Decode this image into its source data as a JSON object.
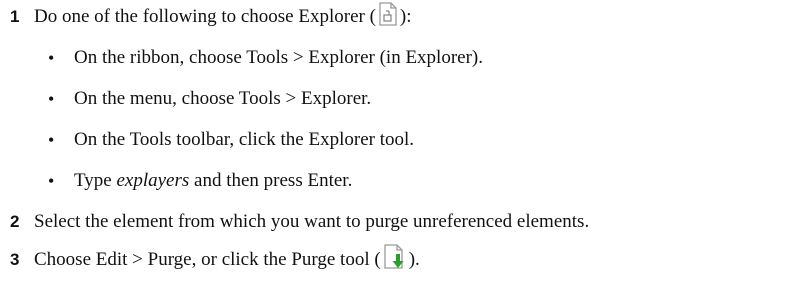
{
  "steps": [
    {
      "number": "1",
      "text_before": "Do one of the following to choose Explorer (",
      "icon": "explorer-document-icon",
      "text_after": "):",
      "bullets": [
        {
          "text": "On the ribbon, choose Tools > Explorer (in Explorer)."
        },
        {
          "text": "On the menu, choose Tools > Explorer."
        },
        {
          "text": "On the Tools toolbar, click the Explorer tool."
        },
        {
          "text_before": "Type ",
          "italic": "explayers",
          "text_after": " and then press Enter."
        }
      ]
    },
    {
      "number": "2",
      "text": "Select the element from which you want to purge unreferenced elements."
    },
    {
      "number": "3",
      "text_before": "Choose Edit > Purge, or click the Purge tool (",
      "icon": "purge-download-icon",
      "text_after": ")."
    }
  ],
  "colors": {
    "text": "#111111",
    "icon_outline": "#9a9a9a",
    "purge_arrow": "#2e9c2e"
  }
}
